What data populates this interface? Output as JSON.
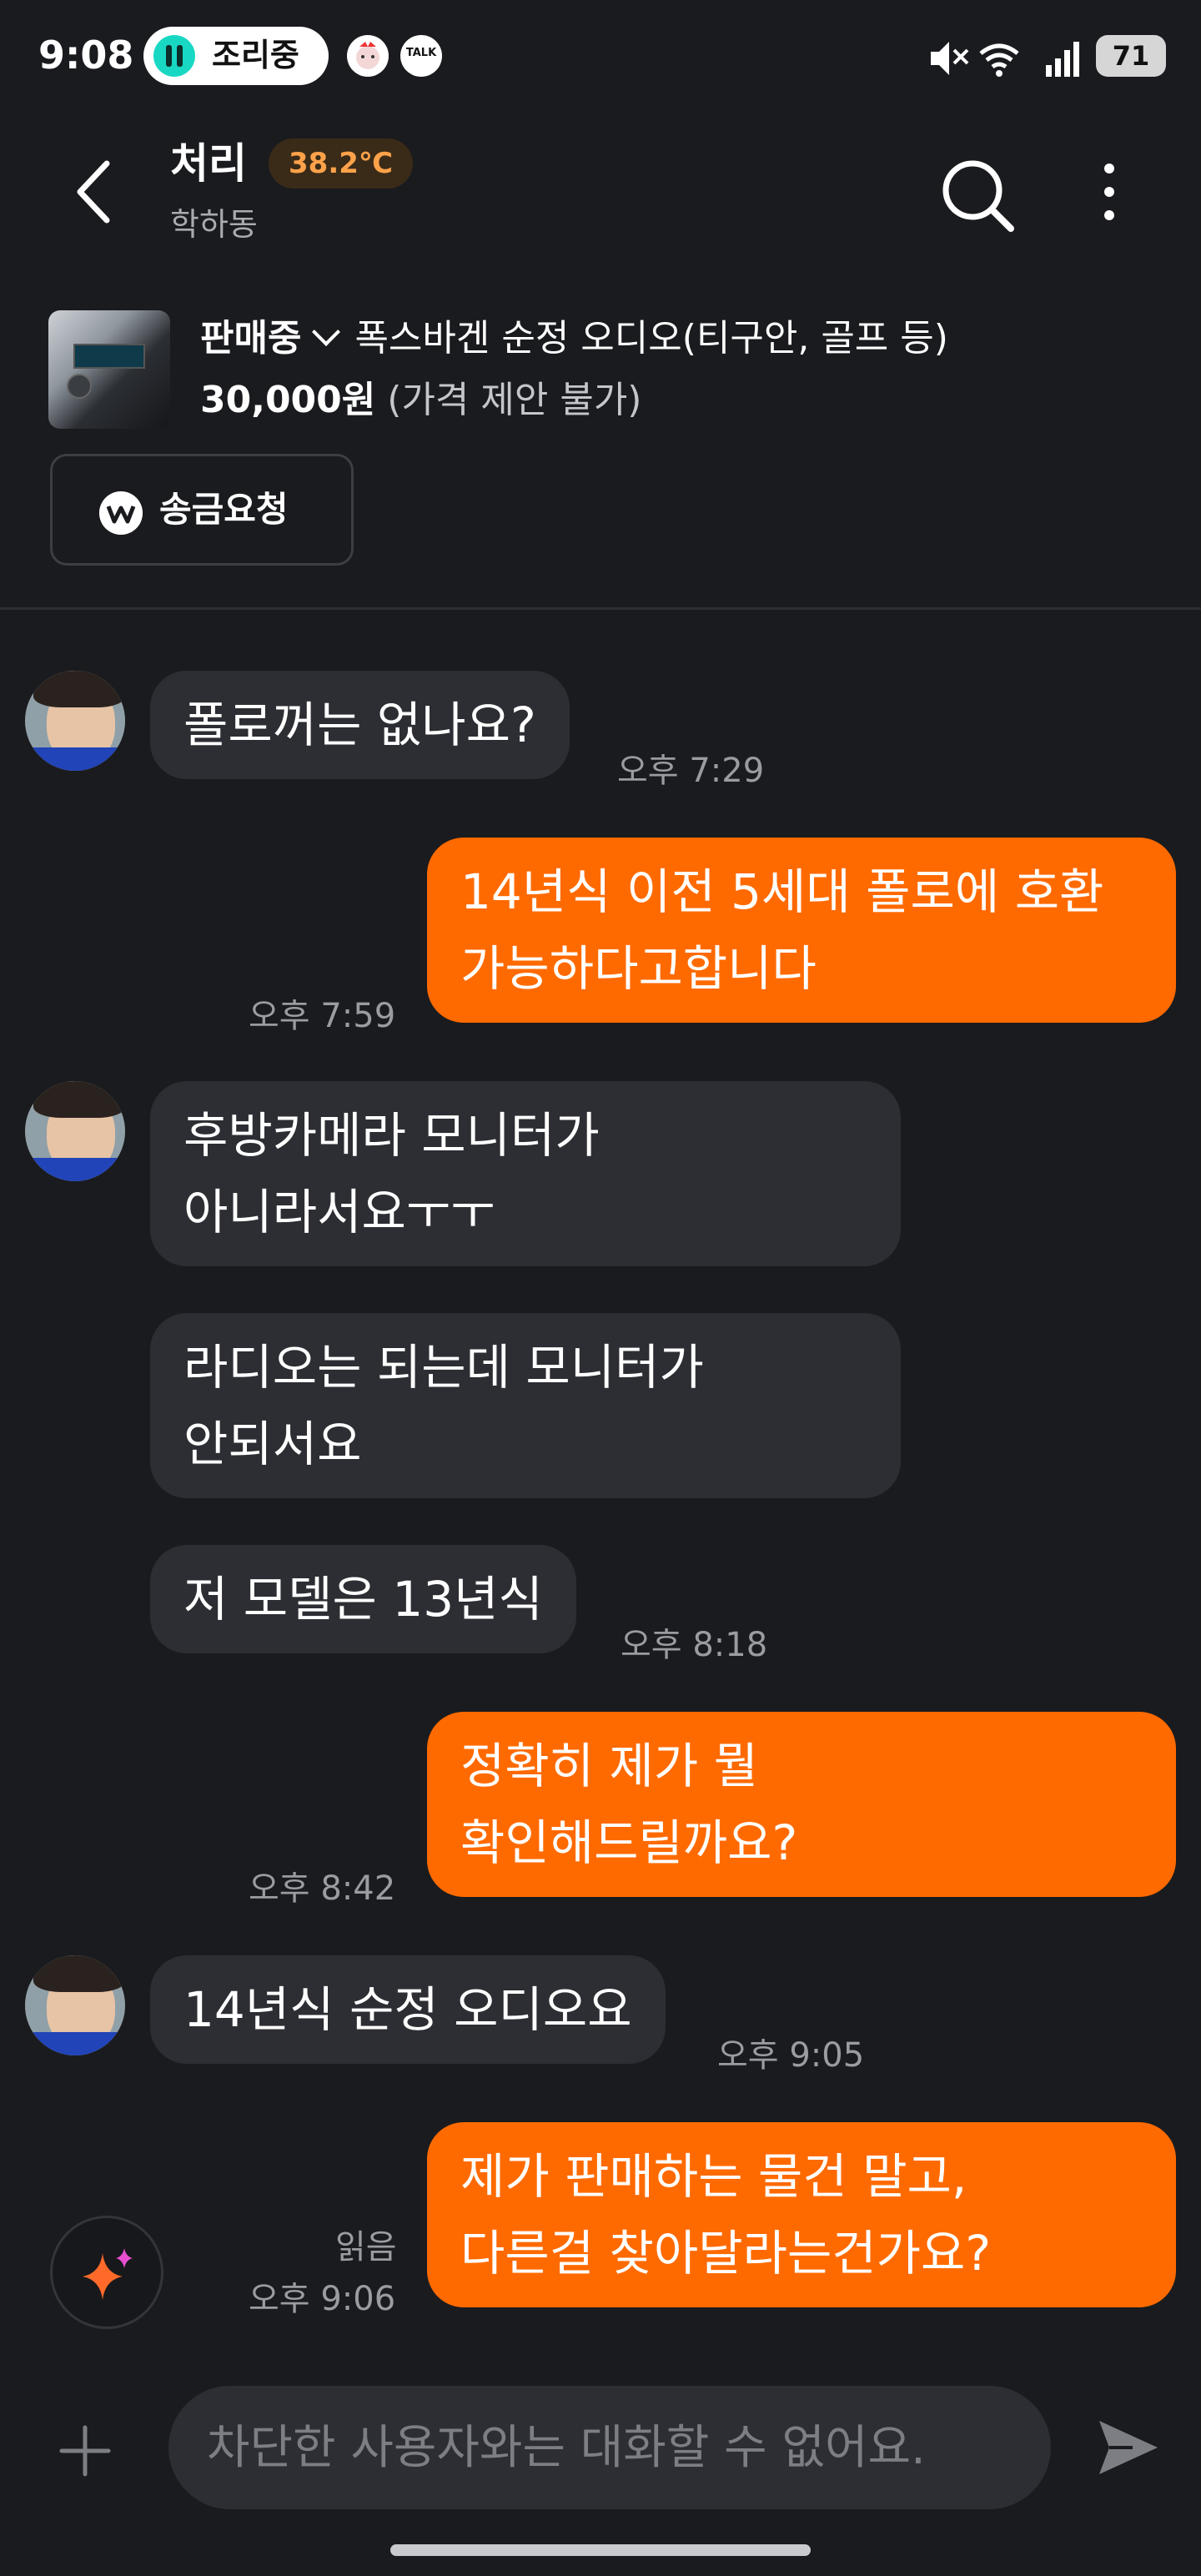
{
  "status_bar": {
    "time": "9:08",
    "pill_label": "조리중",
    "notif_talk": "TALK",
    "battery": "71"
  },
  "header": {
    "title": "처리",
    "temperature": "38.2℃",
    "location": "학하동"
  },
  "product": {
    "status": "판매중",
    "title": "폭스바겐 순정 오디오(티구안, 골프 등)",
    "price": "30,000원",
    "price_note": "(가격 제안 불가)",
    "remit_button": "송금요청"
  },
  "messages": [
    {
      "dir": "in",
      "lines": [
        "폴로꺼는 없나요?"
      ],
      "time": "오후 7:29"
    },
    {
      "dir": "out",
      "lines": [
        "14년식 이전 5세대 폴로에 호환",
        "가능하다고합니다"
      ],
      "time": "오후 7:59"
    },
    {
      "dir": "in",
      "lines": [
        "후방카메라 모니터가",
        "아니라서요ㅜㅜ"
      ]
    },
    {
      "dir": "in",
      "lines": [
        "라디오는 되는데 모니터가",
        "안되서요"
      ]
    },
    {
      "dir": "in",
      "lines": [
        "저 모델은 13년식"
      ],
      "time": "오후 8:18"
    },
    {
      "dir": "out",
      "lines": [
        "정확히 제가 뭘",
        "확인해드릴까요?"
      ],
      "time": "오후 8:42"
    },
    {
      "dir": "in",
      "lines": [
        "14년식 순정 오디오요"
      ],
      "time": "오후 9:05"
    },
    {
      "dir": "out",
      "lines": [
        "제가 판매하는 물건 말고,",
        "다른걸 찾아달라는건가요?"
      ],
      "time": "오후 9:06",
      "read": "읽음"
    }
  ],
  "input": {
    "placeholder": "차단한 사용자와는 대화할 수 없어요."
  },
  "colors": {
    "background": "#1a1b1e",
    "outgoing_bubble": "#ff6a00",
    "incoming_bubble": "#2c2e33",
    "temperature": "#ffa24a"
  },
  "icons": [
    "back-arrow-icon",
    "search-icon",
    "more-vertical-icon",
    "chevron-down-icon",
    "won-icon",
    "sparkle-icon",
    "plus-icon",
    "send-icon"
  ]
}
